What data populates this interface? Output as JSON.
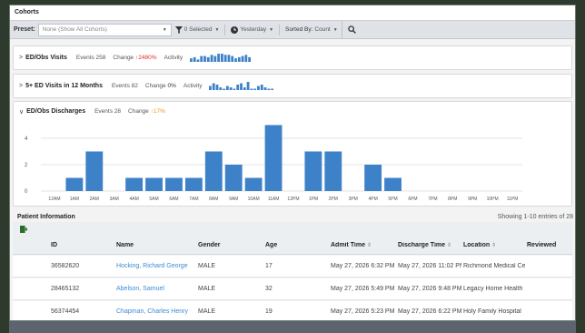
{
  "header": {
    "title": "Cohorts"
  },
  "toolbar": {
    "preset_label": "Preset:",
    "preset_value": "None (Show All Cohorts)",
    "selected_label": "0 Selected",
    "date_label": "Yesterday",
    "sort_prefix": "Sorted By:",
    "sort_value": "Count"
  },
  "panels": [
    {
      "title": "ED/Obs Visits",
      "events": "Events 258",
      "change_label": "Change",
      "change_value": "2480%",
      "activity": "Activity",
      "spark": [
        3,
        4,
        2,
        5,
        5,
        4,
        6,
        5,
        7,
        7,
        6,
        6,
        5,
        3,
        4,
        5,
        6,
        4
      ]
    },
    {
      "title": "5+ ED Visits in 12 Months",
      "events": "Events 82",
      "change_label": "Change",
      "change_value": "0%",
      "activity": "Activity",
      "spark": [
        3,
        5,
        4,
        2,
        1,
        3,
        2,
        1,
        4,
        5,
        2,
        6,
        1,
        1,
        3,
        4,
        2,
        1,
        1
      ]
    },
    {
      "title": "ED/Obs Discharges",
      "events": "Events 28",
      "change_label": "Change",
      "change_value": "17%"
    }
  ],
  "chart_data": {
    "type": "bar",
    "categories": [
      "12AM",
      "1AM",
      "2AM",
      "3AM",
      "4AM",
      "5AM",
      "6AM",
      "7AM",
      "8AM",
      "9AM",
      "10AM",
      "11AM",
      "12PM",
      "1PM",
      "2PM",
      "3PM",
      "4PM",
      "5PM",
      "6PM",
      "7PM",
      "8PM",
      "9PM",
      "10PM",
      "11PM"
    ],
    "values": [
      0,
      1,
      3,
      0,
      1,
      1,
      1,
      1,
      3,
      2,
      1,
      5,
      0,
      3,
      3,
      0,
      2,
      1,
      0,
      0,
      0,
      0,
      0,
      0
    ],
    "ylim": [
      0,
      5
    ],
    "yticks": [
      0,
      2,
      4
    ],
    "grid": true,
    "color": "#3d82c8"
  },
  "patient_info": {
    "title": "Patient Information",
    "showing": "Showing 1-10 entries of 28",
    "columns": [
      "ID",
      "Name",
      "Gender",
      "Age",
      "Admit Time",
      "Discharge Time",
      "Location",
      "Reviewed"
    ],
    "rows": [
      {
        "id": "36582620",
        "name": "Hocking, Richard George",
        "gender": "MALE",
        "age": "17",
        "admit": "May 27, 2026 6:32 PM",
        "discharge": "May 27, 2026 11:02 PM",
        "location": "Richmond Medical Center",
        "reviewed": ""
      },
      {
        "id": "28465132",
        "name": "Abelson, Samuel",
        "gender": "MALE",
        "age": "32",
        "admit": "May 27, 2026 5:49 PM",
        "discharge": "May 27, 2026 9:48 PM",
        "location": "Legacy Home Health",
        "reviewed": ""
      },
      {
        "id": "56374454",
        "name": "Chapman, Charles Henry",
        "gender": "MALE",
        "age": "19",
        "admit": "May 27, 2026 5:23 PM",
        "discharge": "May 27, 2026 6:22 PM",
        "location": "Holy Family Hospital",
        "reviewed": ""
      }
    ]
  }
}
